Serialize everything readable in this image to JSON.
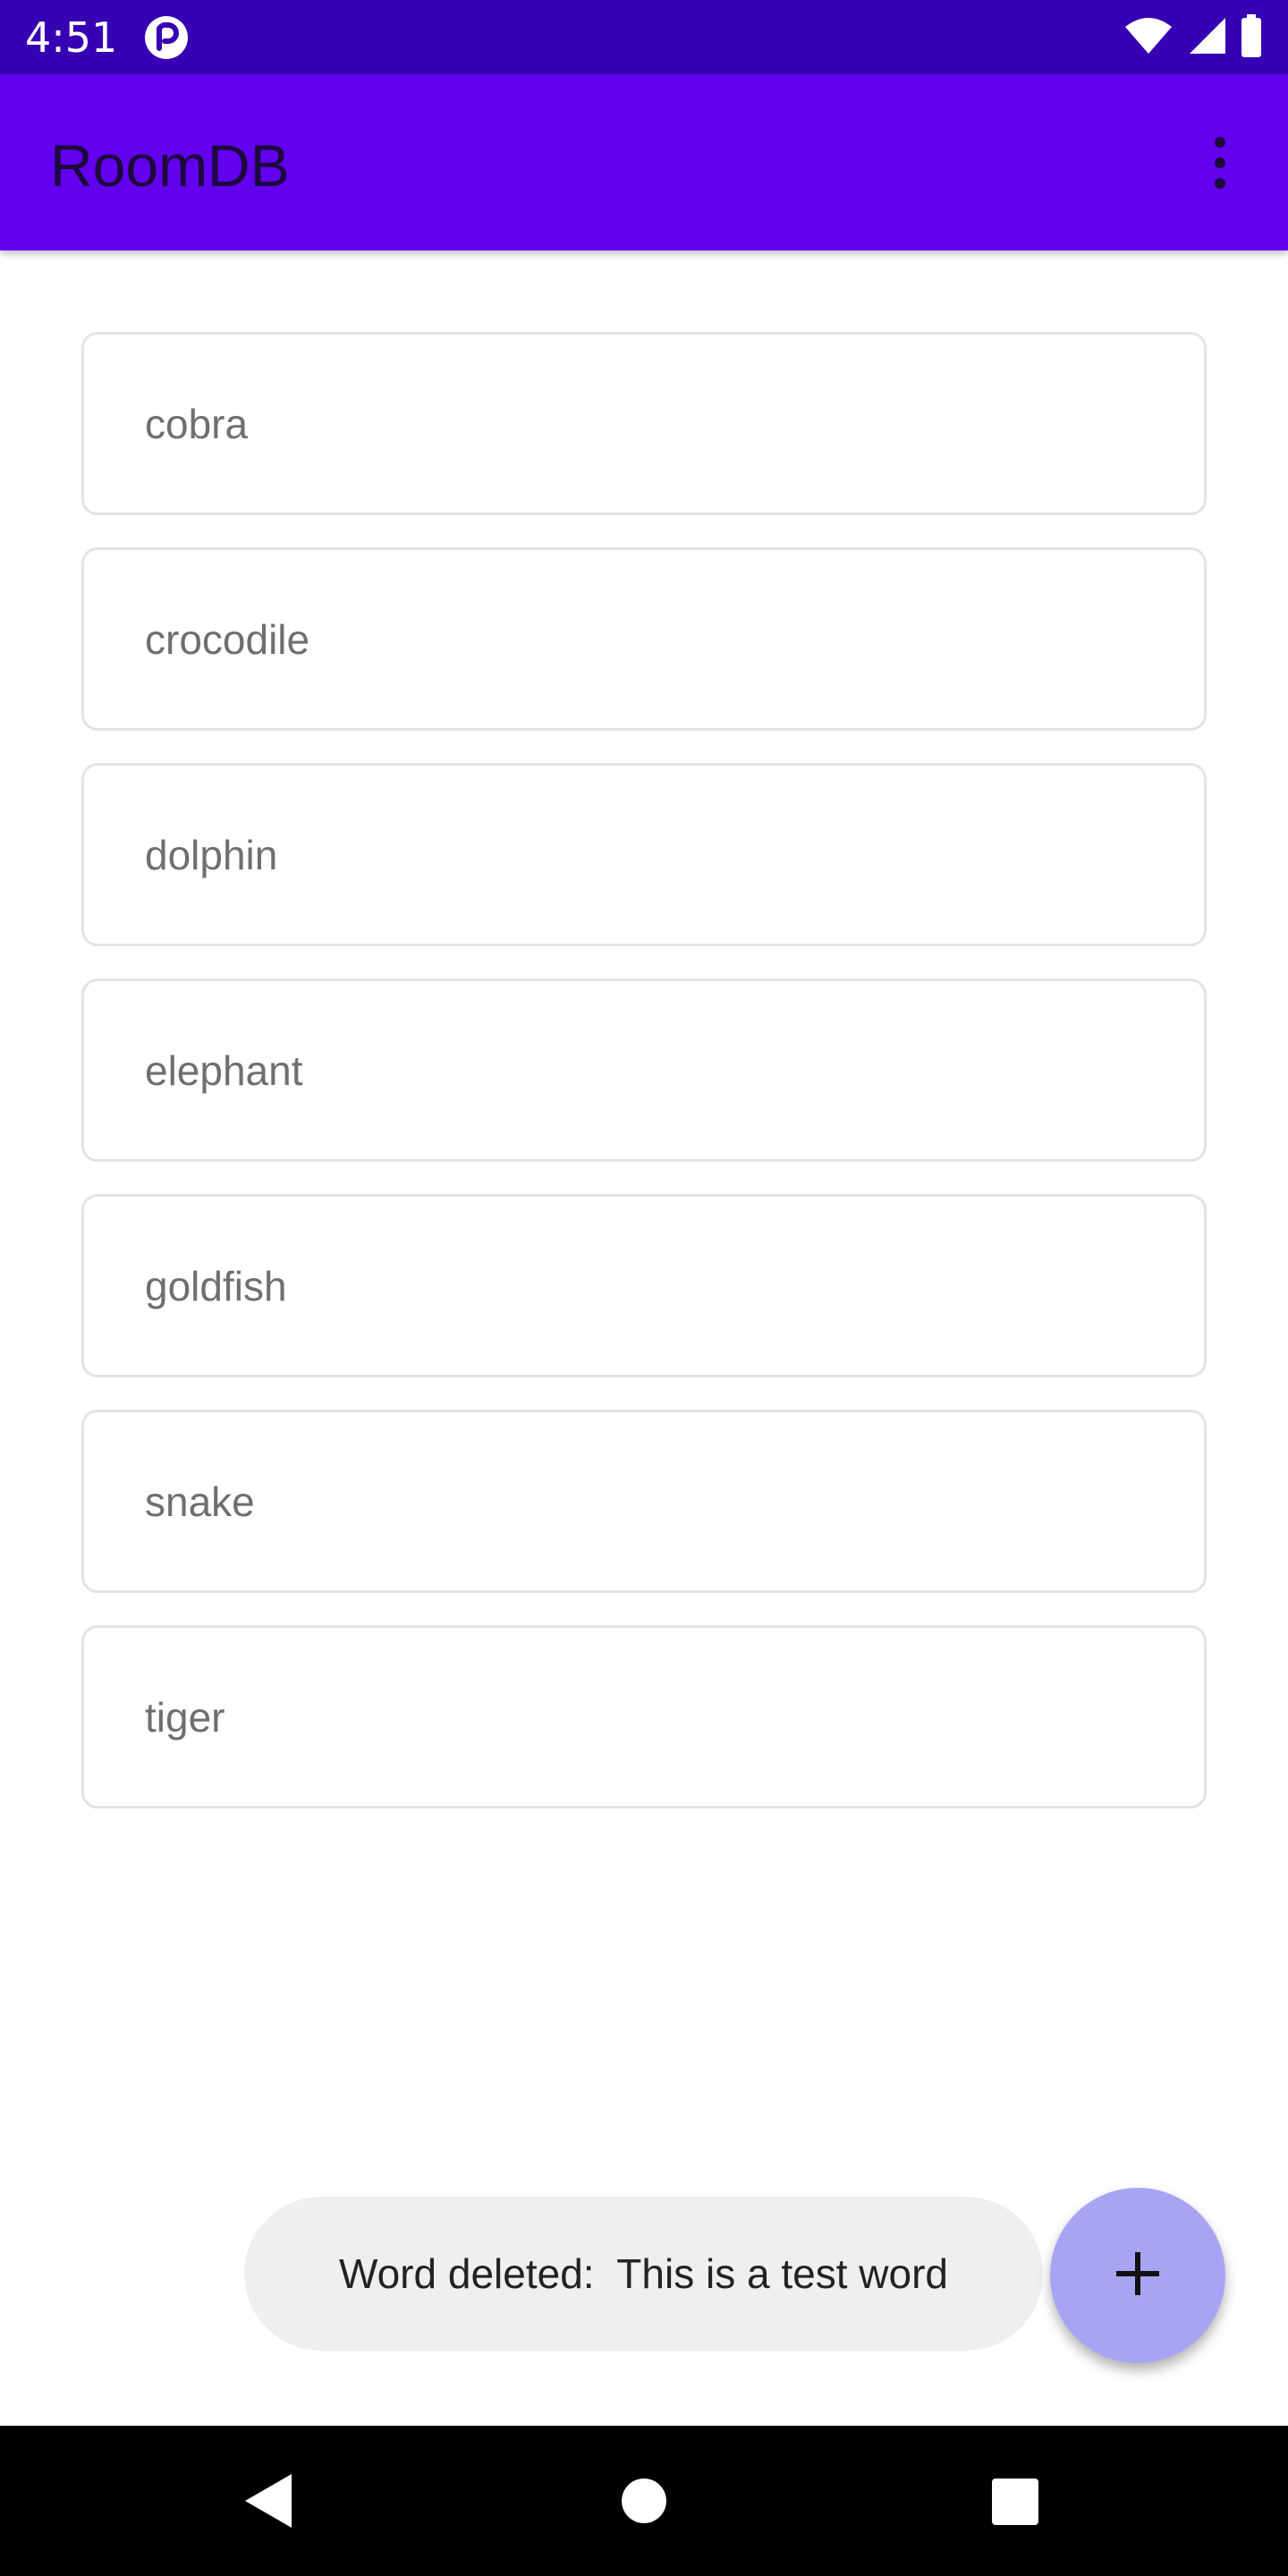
{
  "status_bar": {
    "time": "4:51",
    "icons": [
      "app-notification-icon",
      "wifi-icon",
      "signal-icon",
      "battery-icon"
    ]
  },
  "app_bar": {
    "title": "RoomDB",
    "menu_icon": "more-vert-icon"
  },
  "words": [
    {
      "text": "cobra"
    },
    {
      "text": "crocodile"
    },
    {
      "text": "dolphin"
    },
    {
      "text": "elephant"
    },
    {
      "text": "goldfish"
    },
    {
      "text": "snake"
    },
    {
      "text": "tiger"
    }
  ],
  "snackbar": {
    "message": "Word deleted:  This is a test word"
  },
  "fab": {
    "icon": "plus-icon"
  },
  "nav_bar": {
    "buttons": [
      "back-icon",
      "home-icon",
      "recents-icon"
    ]
  },
  "colors": {
    "status_bar": "#3700b3",
    "app_bar": "#6200ee",
    "fab": "#a8a4f4",
    "snackbar": "#efefef"
  }
}
